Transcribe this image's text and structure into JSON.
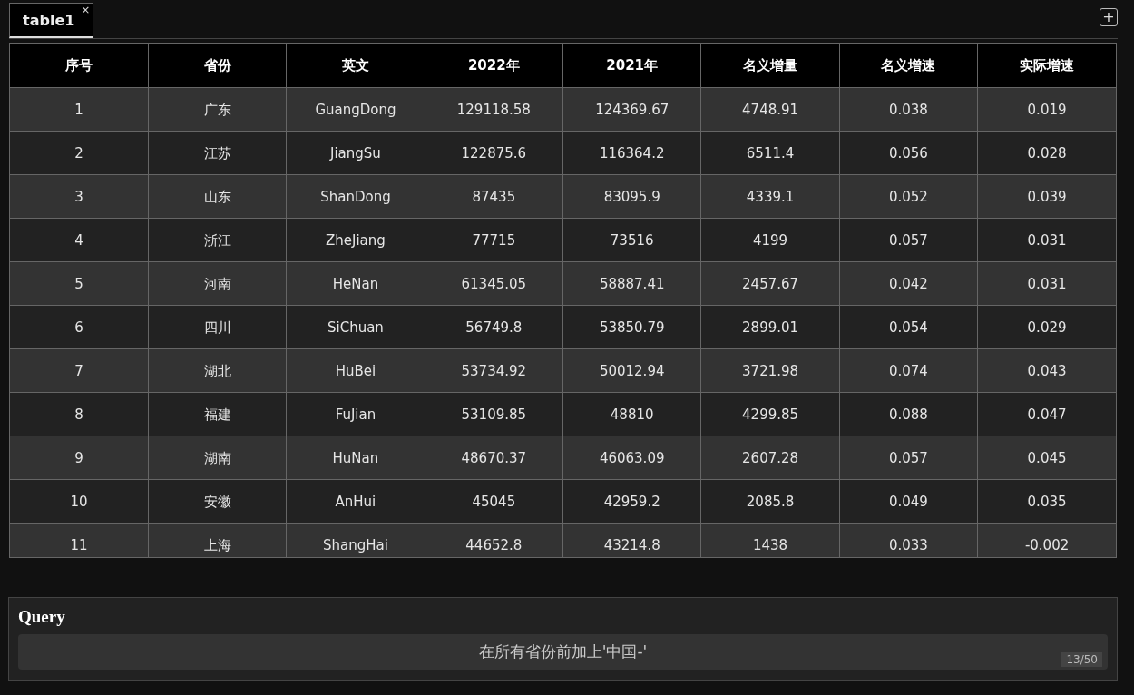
{
  "tabs": [
    {
      "label": "table1",
      "selected": true,
      "close": "×"
    }
  ],
  "add_button": "+",
  "table": {
    "columns": [
      "序号",
      "省份",
      "英文",
      "2022年",
      "2021年",
      "名义增量",
      "名义增速",
      "实际增速"
    ],
    "rows": [
      [
        "1",
        "广东",
        "GuangDong",
        "129118.58",
        "124369.67",
        "4748.91",
        "0.038",
        "0.019"
      ],
      [
        "2",
        "江苏",
        "JiangSu",
        "122875.6",
        "116364.2",
        "6511.4",
        "0.056",
        "0.028"
      ],
      [
        "3",
        "山东",
        "ShanDong",
        "87435",
        "83095.9",
        "4339.1",
        "0.052",
        "0.039"
      ],
      [
        "4",
        "浙江",
        "ZheJiang",
        "77715",
        "73516",
        "4199",
        "0.057",
        "0.031"
      ],
      [
        "5",
        "河南",
        "HeNan",
        "61345.05",
        "58887.41",
        "2457.67",
        "0.042",
        "0.031"
      ],
      [
        "6",
        "四川",
        "SiChuan",
        "56749.8",
        "53850.79",
        "2899.01",
        "0.054",
        "0.029"
      ],
      [
        "7",
        "湖北",
        "HuBei",
        "53734.92",
        "50012.94",
        "3721.98",
        "0.074",
        "0.043"
      ],
      [
        "8",
        "福建",
        "FuJian",
        "53109.85",
        "48810",
        "4299.85",
        "0.088",
        "0.047"
      ],
      [
        "9",
        "湖南",
        "HuNan",
        "48670.37",
        "46063.09",
        "2607.28",
        "0.057",
        "0.045"
      ],
      [
        "10",
        "安徽",
        "AnHui",
        "45045",
        "42959.2",
        "2085.8",
        "0.049",
        "0.035"
      ],
      [
        "11",
        "上海",
        "ShangHai",
        "44652.8",
        "43214.8",
        "1438",
        "0.033",
        "-0.002"
      ]
    ]
  },
  "query": {
    "title": "Query",
    "value": "在所有省份前加上'中国-'",
    "counter": "13/50"
  }
}
